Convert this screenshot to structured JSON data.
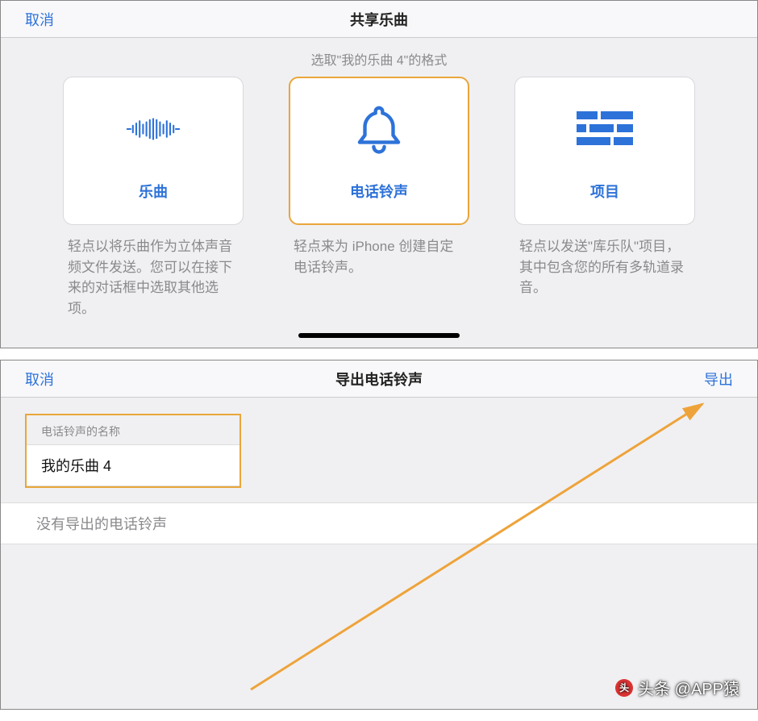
{
  "top": {
    "cancel": "取消",
    "title": "共享乐曲",
    "subtitle": "选取\"我的乐曲 4\"的格式",
    "cards": {
      "song": {
        "label": "乐曲",
        "desc": "轻点以将乐曲作为立体声音频文件发送。您可以在接下来的对话框中选取其他选项。"
      },
      "ring": {
        "label": "电话铃声",
        "desc": "轻点来为 iPhone 创建自定电话铃声。"
      },
      "proj": {
        "label": "项目",
        "desc": "轻点以发送\"库乐队\"项目，其中包含您的所有多轨道录音。"
      }
    }
  },
  "bottom": {
    "cancel": "取消",
    "title": "导出电话铃声",
    "export": "导出",
    "field_caption": "电话铃声的名称",
    "field_value": "我的乐曲 4",
    "empty_note": "没有导出的电话铃声"
  },
  "watermark": "头条 @APP猿"
}
